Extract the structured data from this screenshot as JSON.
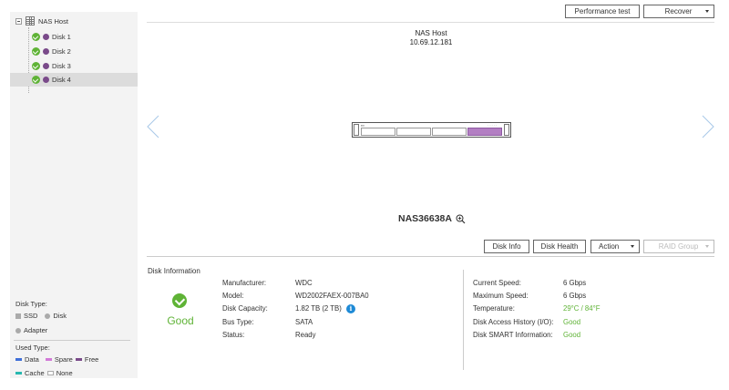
{
  "tree": {
    "host_label": "NAS Host",
    "disks": [
      {
        "label": "Disk 1",
        "selected": false
      },
      {
        "label": "Disk 2",
        "selected": false
      },
      {
        "label": "Disk 3",
        "selected": false
      },
      {
        "label": "Disk 4",
        "selected": true
      }
    ]
  },
  "legend": {
    "disk_type_label": "Disk Type:",
    "ssd_label": "SSD",
    "disk_label": "Disk",
    "adapter_label": "Adapter",
    "used_type_label": "Used Type:",
    "data_label": "Data",
    "spare_label": "Spare",
    "free_label": "Free",
    "cache_label": "Cache",
    "none_label": "None",
    "colors": {
      "data": "#3f6fd8",
      "spare": "#d27ad8",
      "free": "#7a4a8a",
      "cache": "#27b8b0",
      "none": "#ffffff",
      "ssd": "#aaaaaa",
      "disk": "#aaaaaa",
      "adapter": "#aaaaaa"
    }
  },
  "toolbar": {
    "performance_test_label": "Performance test",
    "recover_label": "Recover"
  },
  "host": {
    "name": "NAS Host",
    "ip": "10.69.12.181"
  },
  "enclosure": {
    "model": "NAS36638A",
    "selected_bay": 4
  },
  "actions": {
    "disk_info_label": "Disk Info",
    "disk_health_label": "Disk Health",
    "action_label": "Action",
    "raid_group_label": "RAID Group"
  },
  "disk_info": {
    "section_title": "Disk Information",
    "health_status": "Good",
    "left": [
      {
        "label": "Manufacturer:",
        "value": "WDC"
      },
      {
        "label": "Model:",
        "value": "WD2002FAEX-007BA0"
      },
      {
        "label": "Disk Capacity:",
        "value": "1.82 TB (2 TB)"
      },
      {
        "label": "Bus Type:",
        "value": "SATA"
      },
      {
        "label": "Status:",
        "value": "Ready"
      }
    ],
    "right": [
      {
        "label": "Current Speed:",
        "value": "6 Gbps"
      },
      {
        "label": "Maximum Speed:",
        "value": "6 Gbps"
      },
      {
        "label": "Temperature:",
        "value": "29°C / 84°F"
      },
      {
        "label": "Disk Access History (I/O):",
        "value": "Good"
      },
      {
        "label": "Disk SMART Information:",
        "value": "Good"
      }
    ],
    "status_color": "#5fb336"
  }
}
